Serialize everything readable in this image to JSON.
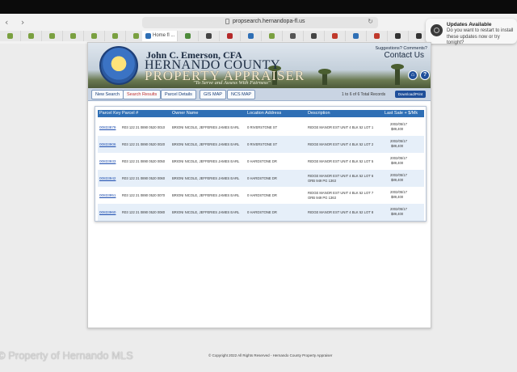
{
  "browser": {
    "url": "propsearch.hernandopa-fl.us",
    "nav_arrows": "‹ ›",
    "reload": "↻",
    "active_tab": "Home fl ..."
  },
  "notification": {
    "title": "Updates Available",
    "body": "Do you want to restart to install these updates now or try tonight?"
  },
  "banner": {
    "line1": "John C. Emerson, CFA",
    "line2": "HERNANDO COUNTY",
    "line3": "PROPERTY APPRAISER",
    "tagline": "\"To Serve and Assess With Fairness\"",
    "questions": "Suggestions? Comments?",
    "contact": "Contact Us",
    "home_icon": "⌂",
    "help_icon": "?"
  },
  "nav": {
    "buttons": [
      "New Search",
      "Search Results",
      "Parcel Details",
      "GIS MAP",
      "NCS MAP"
    ],
    "records": "1 to 6 of 6 Total Records",
    "download": "Download/Print"
  },
  "table": {
    "headers": [
      "Parcel Key",
      "Parcel #",
      "Owner Name",
      "Location Address",
      "Description",
      "Last Sale + $/Mk"
    ],
    "rows": [
      {
        "key": "00833879",
        "parcel": "R03 122 21 0890 0520 0010",
        "owner": "BRIONI NICOLE, JEFFERIES JAMES EARL",
        "address": "0 RIVERSTONE ST",
        "desc": [
          "RIDGE MANOR EST UNIT 4 BLK 52 LOT 1"
        ],
        "sale": [
          "2002/05/17",
          "$89,400"
        ]
      },
      {
        "key": "00833906",
        "parcel": "R03 122 21 0890 0520 0020",
        "owner": "BRIONI NICOLE, JEFFERIES JAMES EARL",
        "address": "0 RIVERSTONE ST",
        "desc": [
          "RIDGE MANOR EST UNIT 4 BLK 52 LOT 2"
        ],
        "sale": [
          "2002/05/17",
          "$89,400"
        ]
      },
      {
        "key": "00833933",
        "parcel": "R03 122 21 0890 0520 0050",
        "owner": "BRIONI NICOLE, JEFFERIES JAMES EARL",
        "address": "0 HARDSTONE DR",
        "desc": [
          "RIDGE MANOR EST UNIT 4 BLK 52 LOT 5"
        ],
        "sale": [
          "2002/05/17",
          "$89,400"
        ]
      },
      {
        "key": "00833942",
        "parcel": "R03 122 21 0890 0520 0060",
        "owner": "BRIONI NICOLE, JEFFERIES JAMES EARL",
        "address": "0 HARDSTONE DR",
        "desc": [
          "RIDGE MANOR EST UNIT 4 BLK 52 LOT 6",
          "ORB 949 PG 1363"
        ],
        "sale": [
          "2002/05/17",
          "$89,400"
        ]
      },
      {
        "key": "00833951",
        "parcel": "R03 122 21 0890 0520 0070",
        "owner": "BRIONI NICOLE, JEFFERIES JAMES EARL",
        "address": "0 HARDSTONE DR",
        "desc": [
          "RIDGE MANOR EST UNIT 4 BLK 52 LOT 7",
          "ORB 949 PG 1363"
        ],
        "sale": [
          "2002/05/17",
          "$89,400"
        ]
      },
      {
        "key": "00833960",
        "parcel": "R03 122 21 0890 0520 0080",
        "owner": "BRIONI NICOLE, JEFFERIES JAMES EARL",
        "address": "0 HARDSTONE DR",
        "desc": [
          "RIDGE MANOR EST UNIT 4 BLK 52 LOT 8"
        ],
        "sale": [
          "2002/05/17",
          "$89,400"
        ]
      }
    ]
  },
  "footer": {
    "watermark": "© Property of Hernando MLS",
    "copyright": "© Copyright 2022 All Rights Reserved - Hernando County Property Appraiser"
  },
  "colors": {
    "header_blue": "#2f6fb5",
    "link_blue": "#1f4fb0",
    "row_alt": "#e6eff9",
    "selected_tab": "#c03030"
  }
}
